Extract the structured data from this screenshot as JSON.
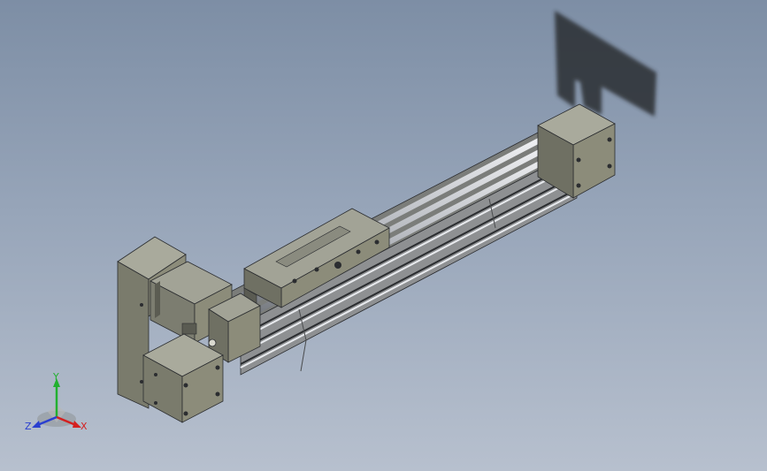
{
  "viewport": {
    "background_top": "#7d8ea5",
    "background_bottom": "#b7c0ce"
  },
  "model": {
    "part": "linear-module-actuator",
    "body_color": "#8c8c7a",
    "rail_color": "#d8dadf",
    "shadow_color": "#2b2d30"
  },
  "triad": {
    "x_label": "X",
    "y_label": "Y",
    "z_label": "Z",
    "x_color": "#d42020",
    "y_color": "#22b030",
    "z_color": "#2a3fd0"
  }
}
